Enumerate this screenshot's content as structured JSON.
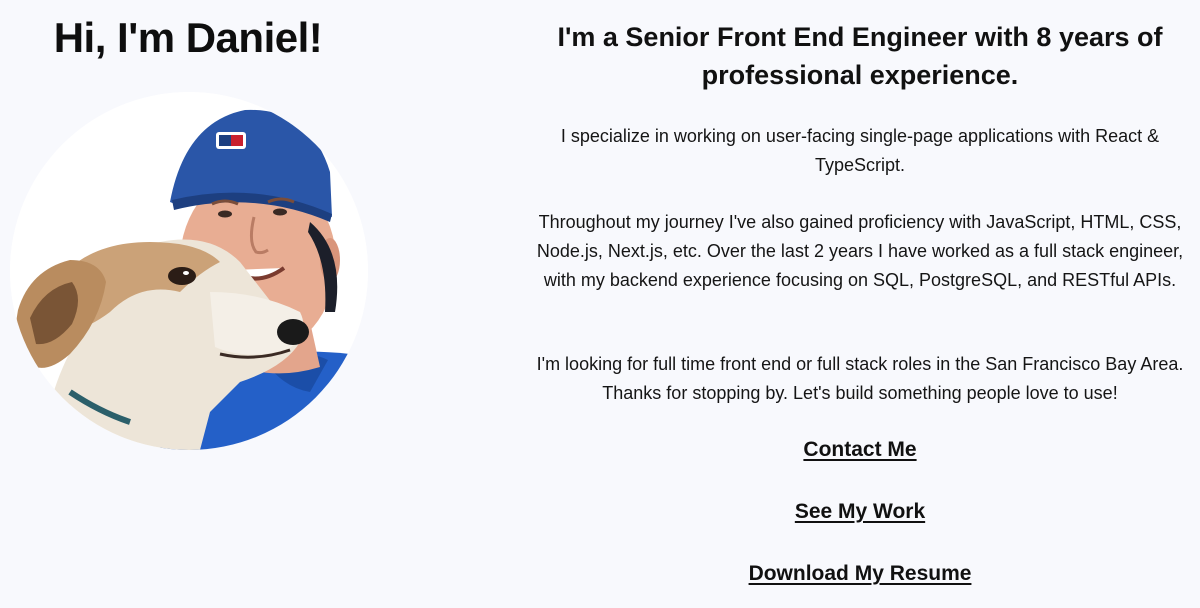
{
  "intro": {
    "greeting": "Hi, I'm Daniel!"
  },
  "about": {
    "headline": "I'm a Senior Front End Engineer with 8 years of professional experience.",
    "paragraphs": [
      "I specialize in working on user-facing single-page applications with React & TypeScript.",
      "Throughout my journey I've also gained proficiency with JavaScript, HTML, CSS, Node.js, Next.js, etc. Over the last 2 years I have worked as a full stack engineer, with my backend experience focusing on SQL, PostgreSQL, and RESTful APIs.",
      "I'm looking for full time front end or full stack roles in the San Francisco Bay Area. Thanks for stopping by. Let's build something people love to use!"
    ]
  },
  "links": {
    "contact": "Contact Me",
    "work": "See My Work",
    "resume": "Download My Resume"
  },
  "colors": {
    "background": "#f8f9fd",
    "text": "#111111",
    "cap_blue": "#2a56a8",
    "shirt_blue": "#2460c8"
  }
}
